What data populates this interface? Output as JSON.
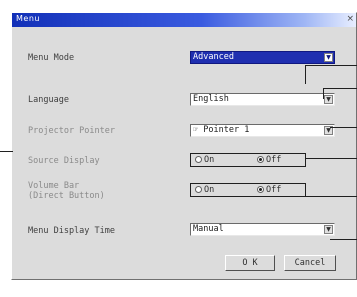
{
  "window": {
    "title": "Menu",
    "close_glyph": "×"
  },
  "rows": {
    "menu_mode": {
      "label": "Menu Mode",
      "value": "Advanced"
    },
    "language": {
      "label": "Language",
      "value": "English"
    },
    "projector_pointer": {
      "label": "Projector Pointer",
      "value": "Pointer 1",
      "icon": "pointer-icon"
    },
    "source_display": {
      "label": "Source Display",
      "on_label": "On",
      "off_label": "Off",
      "selected": "off"
    },
    "volume_bar": {
      "label_line1": "Volume Bar",
      "label_line2": "(Direct Button)",
      "on_label": "On",
      "off_label": "Off",
      "selected": "off"
    },
    "menu_display_time": {
      "label": "Menu Display Time",
      "value": "Manual"
    }
  },
  "buttons": {
    "ok": "O K",
    "cancel": "Cancel"
  },
  "icons": {
    "dropdown": "▼",
    "pointer": "☞"
  },
  "colors": {
    "titlebar": "#1230b8",
    "selection": "#1f2fb0",
    "dialog_bg": "#dcdcdc"
  }
}
